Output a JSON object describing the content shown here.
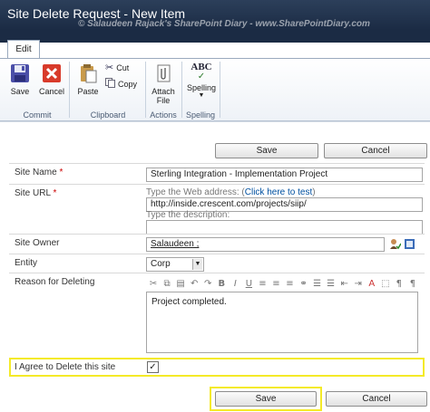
{
  "window": {
    "title": "Site Delete Request - New Item",
    "watermark": "© Salaudeen Rajack's SharePoint Diary - www.SharePointDiary.com"
  },
  "ribbon": {
    "tab_label": "Edit",
    "commit": {
      "group_label": "Commit",
      "save_label": "Save",
      "cancel_label": "Cancel"
    },
    "clipboard": {
      "group_label": "Clipboard",
      "paste_label": "Paste",
      "cut_label": "Cut",
      "copy_label": "Copy"
    },
    "actions": {
      "group_label": "Actions",
      "attach_label_1": "Attach",
      "attach_label_2": "File"
    },
    "spelling": {
      "group_label": "Spelling",
      "spelling_label": "Spelling",
      "abc_text": "ABC"
    }
  },
  "form": {
    "top_save_label": "Save",
    "top_cancel_label": "Cancel",
    "site_name": {
      "label": "Site Name",
      "required": "*",
      "value": "Sterling Integration - Implementation Project"
    },
    "site_url": {
      "label": "Site URL",
      "required": "*",
      "hint_prefix": "Type the Web address: (",
      "hint_link": "Click here to test",
      "hint_suffix": ")",
      "value": "http://inside.crescent.com/projects/siip/",
      "description_hint": "Type the description:",
      "description_value": ""
    },
    "site_owner": {
      "label": "Site Owner",
      "value": "Salaudeen ;"
    },
    "entity": {
      "label": "Entity",
      "value": "Corp"
    },
    "reason": {
      "label": "Reason for Deleting",
      "value": "Project completed."
    },
    "agree": {
      "label": "I Agree to Delete this site",
      "checked": true
    },
    "bottom_save_label": "Save",
    "bottom_cancel_label": "Cancel"
  },
  "colors": {
    "title_bar": "#1b2b44",
    "highlight": "#f4ea28",
    "link": "#0050a0",
    "required": "#cc0000"
  }
}
